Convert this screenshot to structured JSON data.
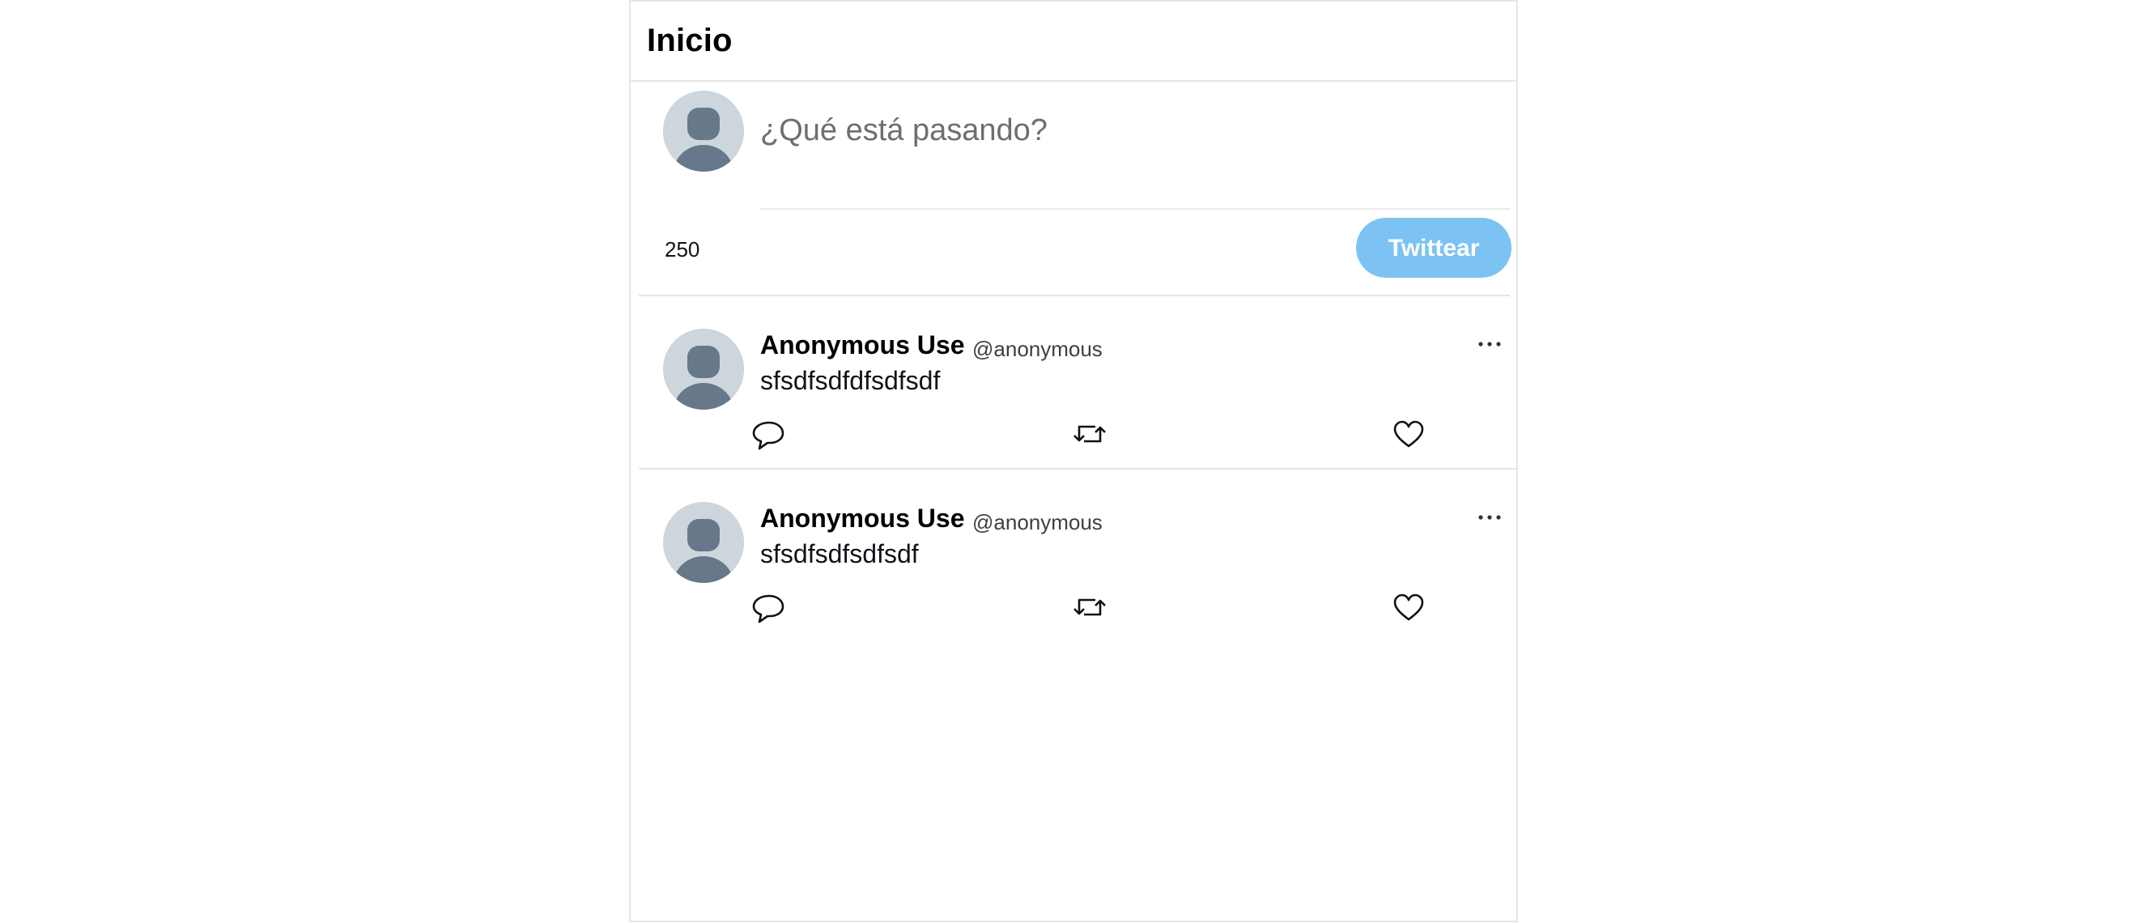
{
  "header": {
    "title": "Inicio"
  },
  "composer": {
    "avatar_icon": "default-user-avatar",
    "placeholder": "¿Qué está pasando?",
    "char_count": "250",
    "tweet_button_label": "Twittear",
    "tweet_button_color": "#7cc3f3"
  },
  "tweets": [
    {
      "name": "Anonymous Use",
      "handle": "@anonymous",
      "text": "sfsdfsdfdfsdfsdf",
      "actions": [
        "reply-icon",
        "retweet-icon",
        "like-icon"
      ],
      "more_icon": "more-options-icon"
    },
    {
      "name": "Anonymous Use",
      "handle": "@anonymous",
      "text": "sfsdfsdfsdfsdf",
      "actions": [
        "reply-icon",
        "retweet-icon",
        "like-icon"
      ],
      "more_icon": "more-options-icon"
    }
  ],
  "colors": {
    "border": "#e6e6e6",
    "avatar_bg": "#cdd6dd",
    "avatar_fg": "#66788a",
    "accent": "#1d9bf0"
  }
}
